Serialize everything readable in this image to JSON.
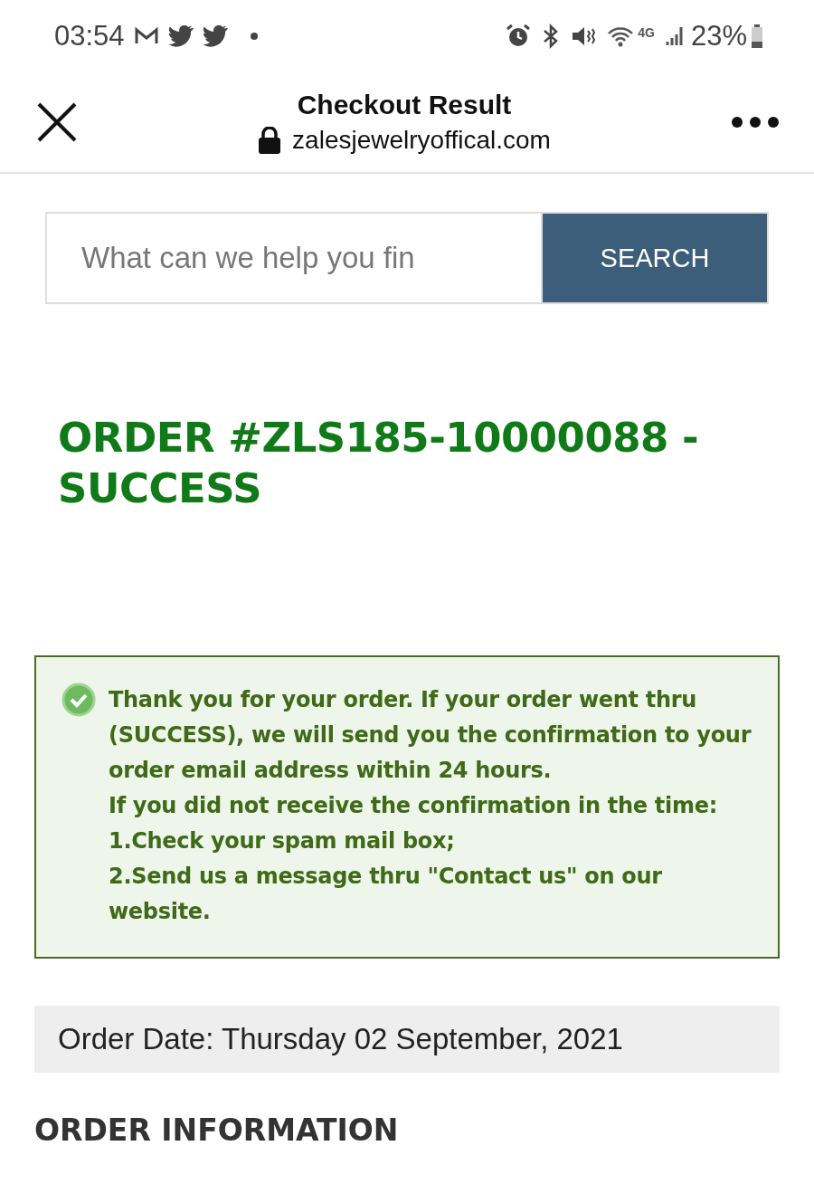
{
  "status_bar": {
    "time": "03:54",
    "network": "4G",
    "battery": "23%"
  },
  "header": {
    "title": "Checkout Result",
    "url": "zalesjewelryoffical.com"
  },
  "search": {
    "placeholder": "What can we help you fin",
    "button": "SEARCH"
  },
  "order_title": "ORDER #ZLS185-10000088 - SUCCESS",
  "message": {
    "lines": [
      "Thank you for your order. If your order went thru (SUCCESS), we will send you the confirmation to your order email address within 24 hours.",
      "If you did not receive the confirmation in the time:",
      "1.Check your spam mail box;",
      "2.Send us a message thru \"Contact us\" on our website."
    ]
  },
  "order_date": "Order Date: Thursday 02 September, 2021",
  "section_heading": "ORDER INFORMATION"
}
